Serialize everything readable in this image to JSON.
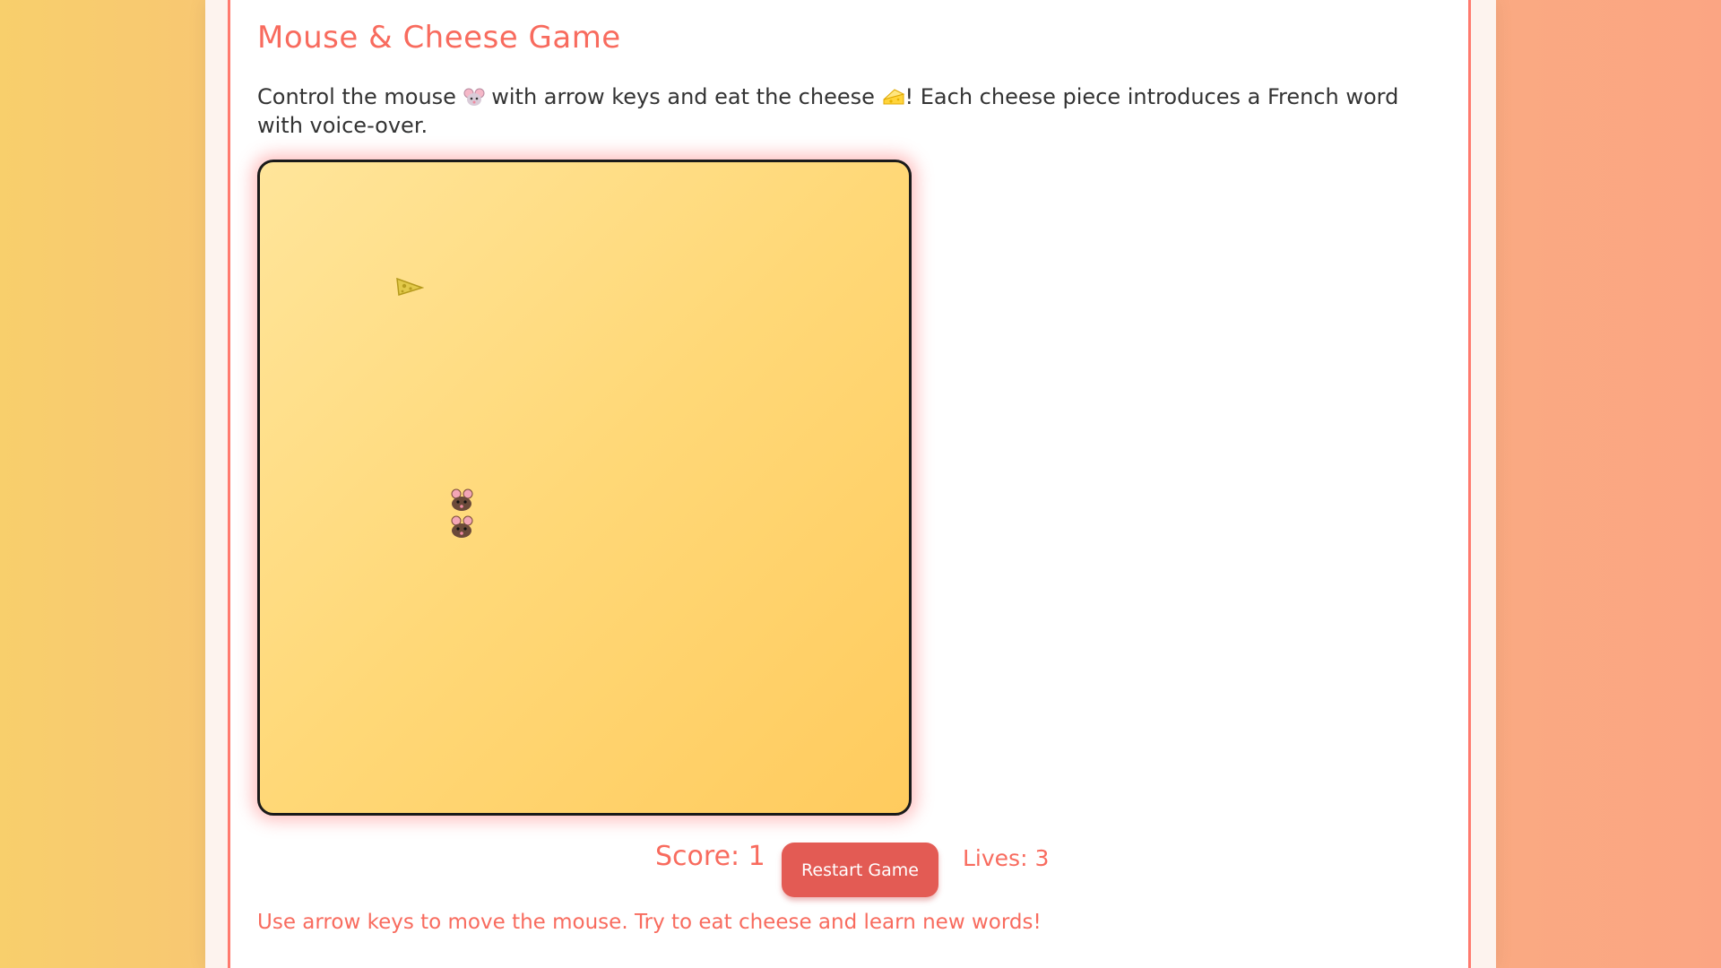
{
  "game": {
    "title": "Mouse & Cheese Game",
    "description_part1": "Control the mouse",
    "description_part2": "with arrow keys and eat the cheese",
    "description_part3": "! Each cheese piece introduces a French word with voice-over.",
    "score_text": "Score: 1",
    "restart_label": "Restart Game",
    "lives_text": "Lives: 3",
    "instructions": "Use arrow keys to move the mouse. Try to eat cheese and learn new words!"
  },
  "icons": {
    "description_mouse": "mouse-icon",
    "description_cheese": "cheese-icon",
    "board_cheese": "cheese-icon",
    "board_mouse": "mouse-icon"
  },
  "colors": {
    "accent": "#f86b5e",
    "button": "#e35b54",
    "board_light": "#ffe59a",
    "board_dark": "#ffcb5e"
  }
}
